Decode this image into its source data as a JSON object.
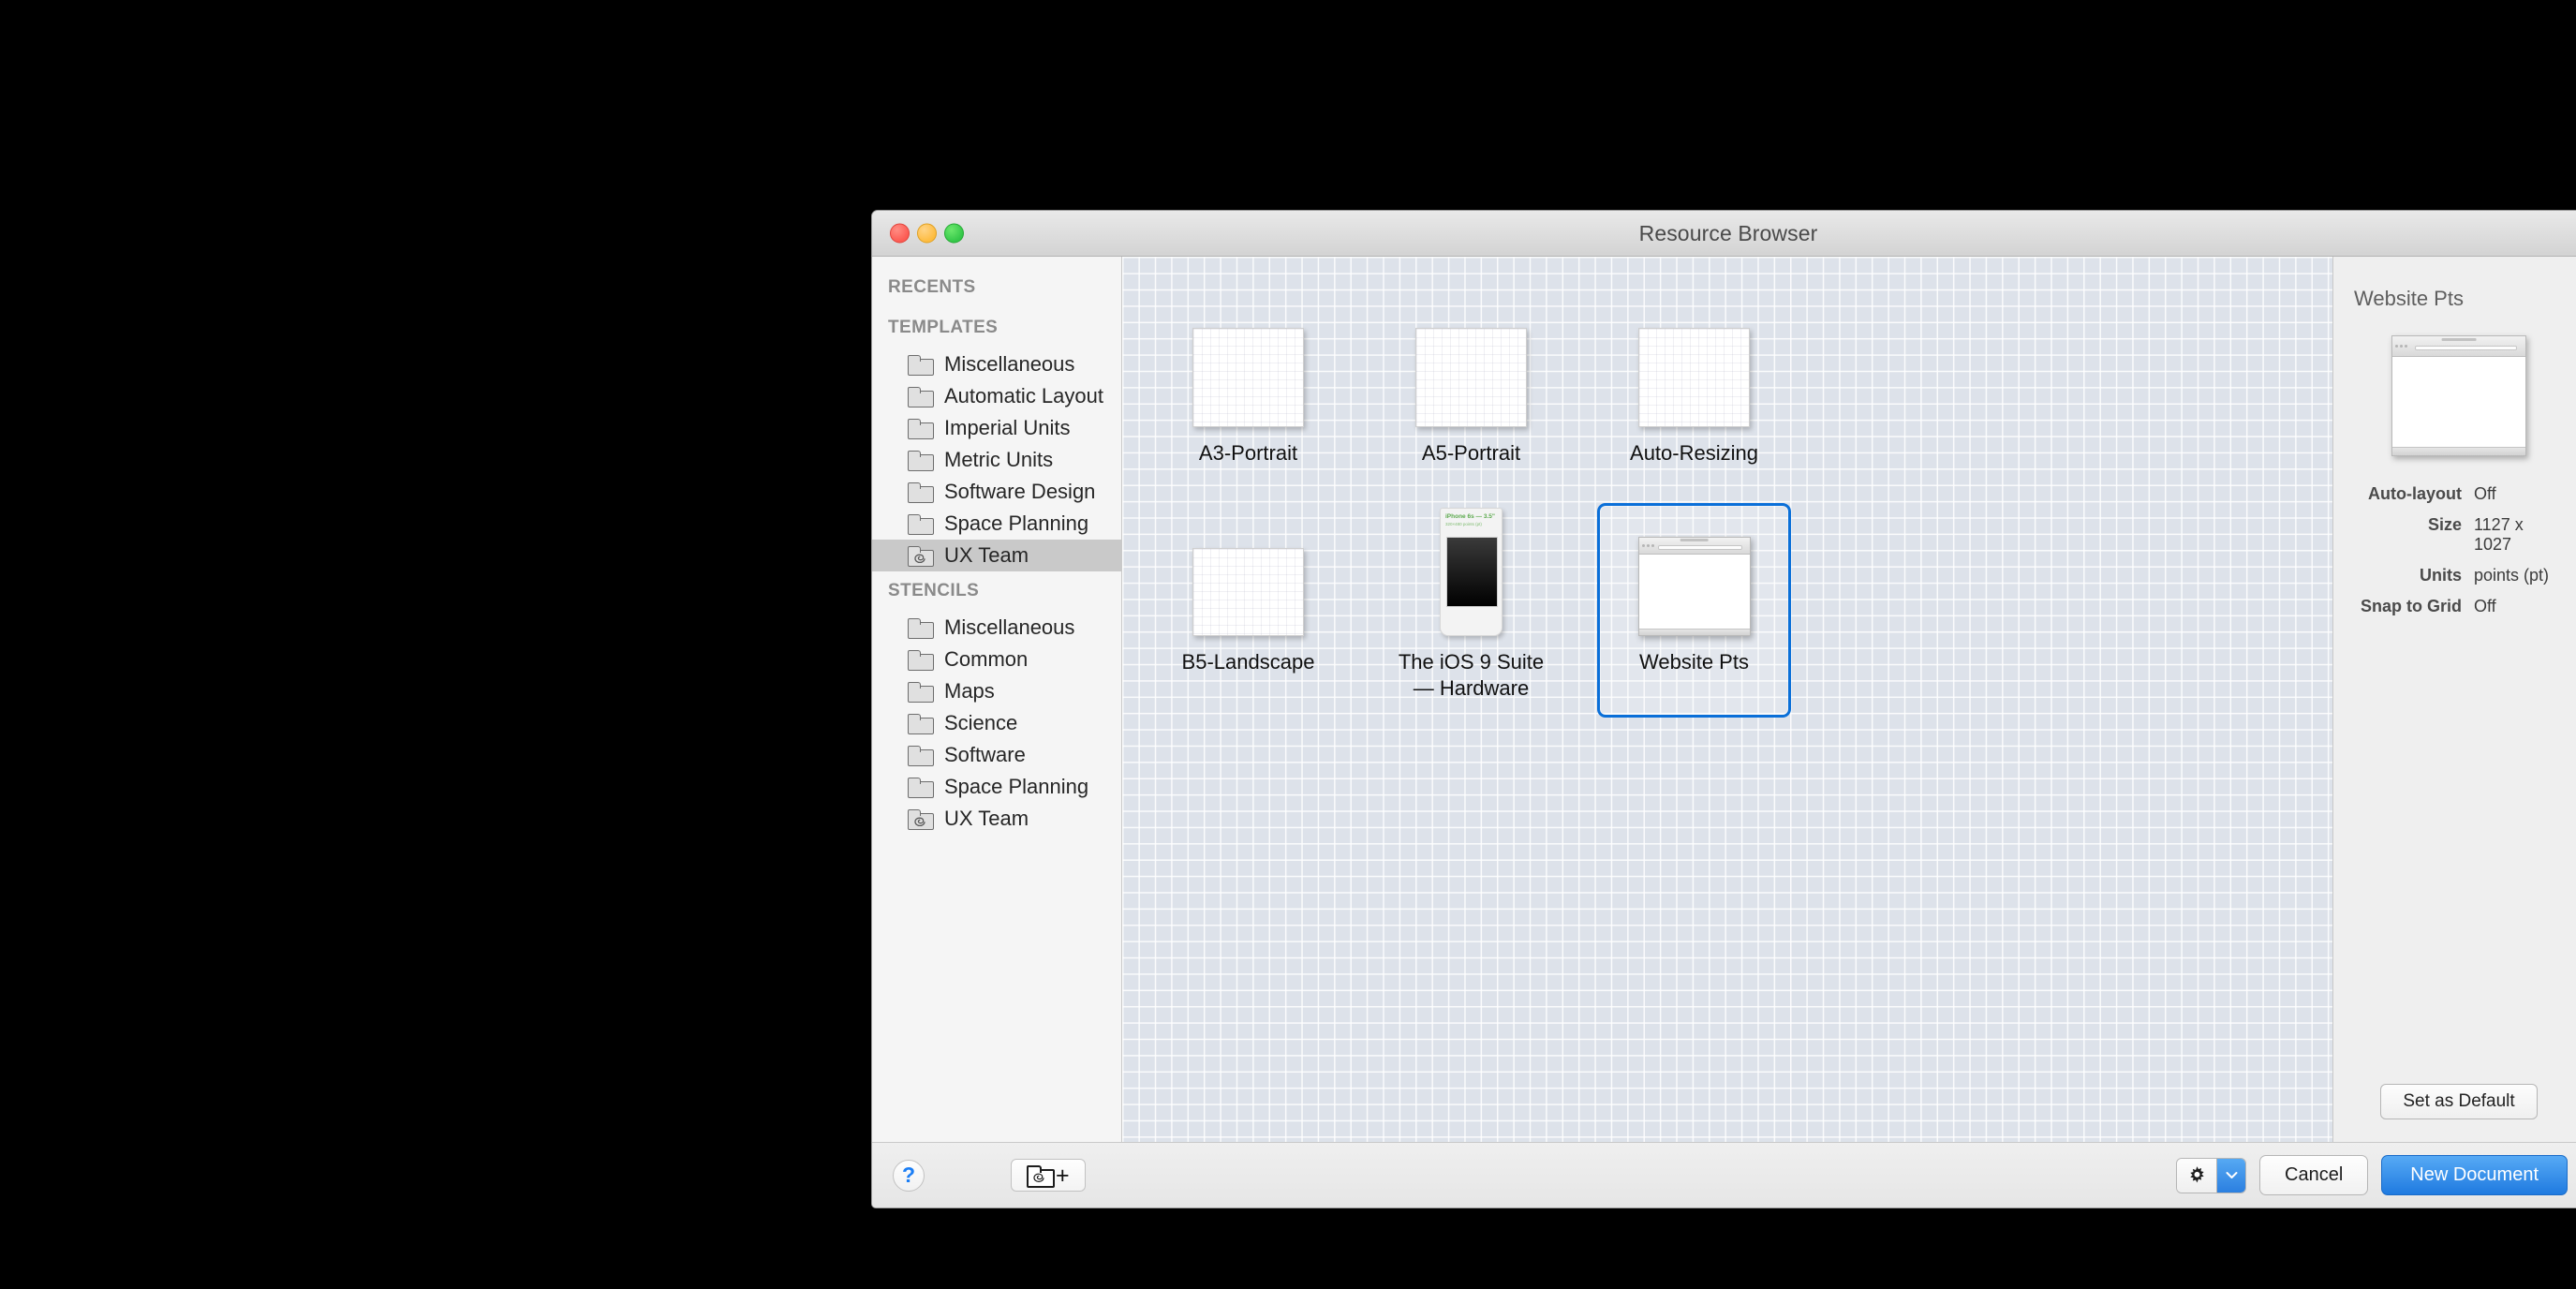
{
  "window": {
    "title": "Resource Browser",
    "traffic_lights": [
      "close",
      "minimize",
      "zoom"
    ]
  },
  "sidebar": {
    "sections": [
      {
        "header": "RECENTS",
        "items": []
      },
      {
        "header": "TEMPLATES",
        "items": [
          {
            "label": "Miscellaneous",
            "icon": "folder-icon",
            "selected": false,
            "disclosure": false
          },
          {
            "label": "Automatic Layout",
            "icon": "folder-icon",
            "selected": false,
            "disclosure": false
          },
          {
            "label": "Imperial Units",
            "icon": "folder-icon",
            "selected": false,
            "disclosure": false
          },
          {
            "label": "Metric Units",
            "icon": "folder-icon",
            "selected": false,
            "disclosure": false
          },
          {
            "label": "Software Design",
            "icon": "folder-icon",
            "selected": false,
            "disclosure": false
          },
          {
            "label": "Space Planning",
            "icon": "folder-icon",
            "selected": false,
            "disclosure": false
          },
          {
            "label": "UX Team",
            "icon": "shared-folder-icon",
            "selected": true,
            "disclosure": true
          }
        ]
      },
      {
        "header": "STENCILS",
        "items": [
          {
            "label": "Miscellaneous",
            "icon": "folder-icon",
            "selected": false,
            "disclosure": false
          },
          {
            "label": "Common",
            "icon": "folder-icon",
            "selected": false,
            "disclosure": false
          },
          {
            "label": "Maps",
            "icon": "folder-icon",
            "selected": false,
            "disclosure": false
          },
          {
            "label": "Science",
            "icon": "folder-icon",
            "selected": false,
            "disclosure": false
          },
          {
            "label": "Software",
            "icon": "folder-icon",
            "selected": false,
            "disclosure": false
          },
          {
            "label": "Space Planning",
            "icon": "folder-icon",
            "selected": false,
            "disclosure": false
          },
          {
            "label": "UX Team",
            "icon": "shared-folder-icon",
            "selected": false,
            "disclosure": true
          }
        ]
      }
    ]
  },
  "canvas": {
    "row1": [
      {
        "caption": "A3-Portrait",
        "thumb": "paper",
        "selected": false
      },
      {
        "caption": "A5-Portrait",
        "thumb": "paper",
        "selected": false
      },
      {
        "caption": "Auto-Resizing",
        "thumb": "paper",
        "selected": false
      }
    ],
    "row2": [
      {
        "caption": "B5-Landscape",
        "thumb": "paper-landscape",
        "selected": false
      },
      {
        "caption": "The iOS 9 Suite — Hardware",
        "thumb": "phone",
        "selected": false,
        "phone_title": "iPhone 6s — 3.5\"",
        "phone_sub": "320×480 points (pt)"
      },
      {
        "caption": "Website Pts",
        "thumb": "browser-window",
        "selected": true
      }
    ]
  },
  "inspector": {
    "title": "Website Pts",
    "preview": "browser-window-preview",
    "meta": [
      {
        "key": "Auto-layout",
        "value": "Off"
      },
      {
        "key": "Size",
        "value": "1127 x 1027"
      },
      {
        "key": "Units",
        "value": "points (pt)"
      },
      {
        "key": "Snap to Grid",
        "value": "Off"
      }
    ],
    "set_default_label": "Set as Default"
  },
  "footer": {
    "help_label": "?",
    "new_folder_plus": "+",
    "gear_chevron": "⌄",
    "cancel_label": "Cancel",
    "new_document_label": "New Document"
  },
  "colors": {
    "accent_blue": "#1f7ae0",
    "selection_border": "#0a6fd8",
    "sidebar_selection": "#c9c9c9",
    "canvas_bg": "#dde2ea"
  }
}
